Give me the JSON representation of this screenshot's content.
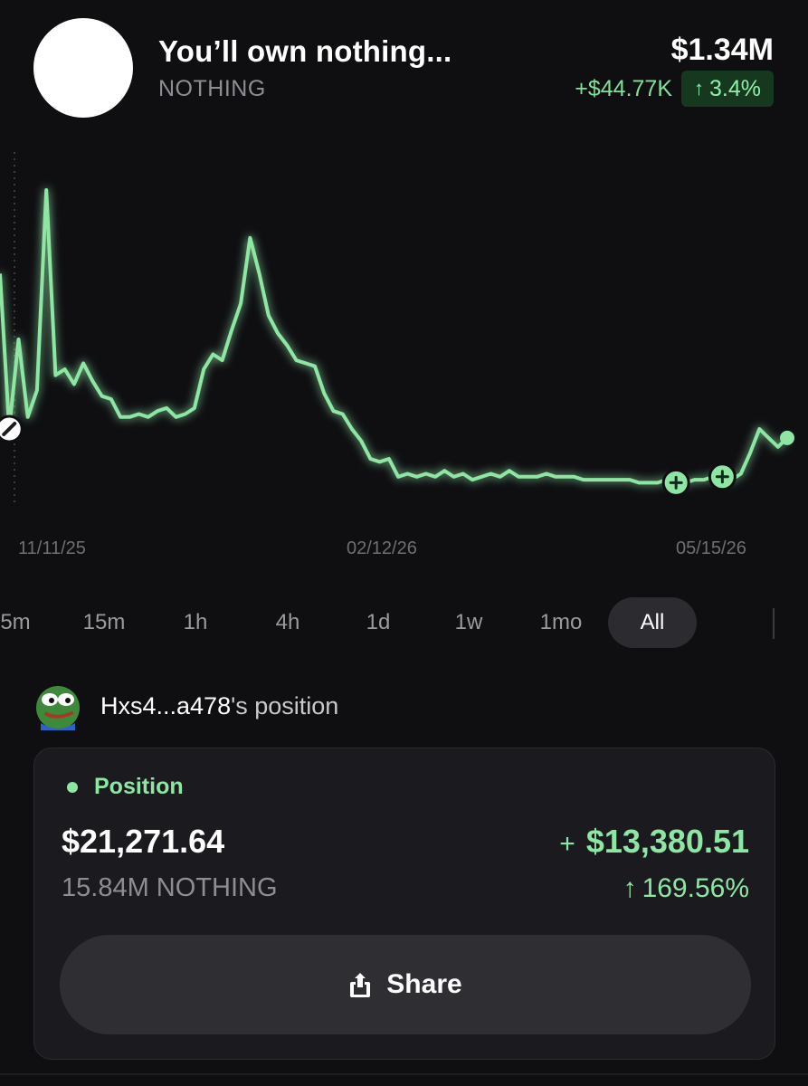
{
  "token": {
    "title": "You’ll own nothing...",
    "ticker": "NOTHING",
    "market_cap": "$1.34M",
    "change_abs": "+$44.77K",
    "change_pct": "3.4%"
  },
  "chart_data": {
    "type": "line",
    "x_tick_labels": [
      "11/11/25",
      "02/12/26",
      "05/15/26"
    ],
    "series": [
      {
        "values": [
          0.72,
          0.2,
          0.5,
          0.24,
          0.33,
          1.0,
          0.38,
          0.4,
          0.35,
          0.42,
          0.36,
          0.31,
          0.3,
          0.24,
          0.24,
          0.25,
          0.24,
          0.26,
          0.27,
          0.24,
          0.25,
          0.27,
          0.4,
          0.45,
          0.43,
          0.53,
          0.62,
          0.84,
          0.72,
          0.58,
          0.52,
          0.48,
          0.43,
          0.42,
          0.41,
          0.32,
          0.26,
          0.25,
          0.2,
          0.16,
          0.1,
          0.09,
          0.1,
          0.04,
          0.05,
          0.04,
          0.05,
          0.04,
          0.06,
          0.04,
          0.05,
          0.03,
          0.04,
          0.05,
          0.04,
          0.06,
          0.04,
          0.04,
          0.04,
          0.05,
          0.04,
          0.04,
          0.04,
          0.03,
          0.03,
          0.03,
          0.03,
          0.03,
          0.03,
          0.02,
          0.02,
          0.02,
          0.03,
          0.02,
          0.02,
          0.03,
          0.03,
          0.04,
          0.04,
          0.03,
          0.05,
          0.12,
          0.2,
          0.17,
          0.14,
          0.17
        ]
      }
    ],
    "markers": [
      "trade-marker",
      "buy-marker",
      "buy-marker"
    ],
    "line_color": "#8ee6a4"
  },
  "timeframes": [
    "5m",
    "15m",
    "1h",
    "4h",
    "1d",
    "1w",
    "1mo",
    "All"
  ],
  "active_timeframe": "All",
  "owner": {
    "name": "Hxs4...a478",
    "suffix": "'s position"
  },
  "position": {
    "label": "Position",
    "value": "$21,271.64",
    "amount": "15.84M NOTHING",
    "pnl_sign": "+",
    "pnl": "$13,380.51",
    "pnl_pct": "169.56%"
  },
  "share_label": "Share",
  "colors": {
    "background": "#0f0f12",
    "accent_green": "#8ee6a4",
    "card": "#1b1b1f"
  }
}
